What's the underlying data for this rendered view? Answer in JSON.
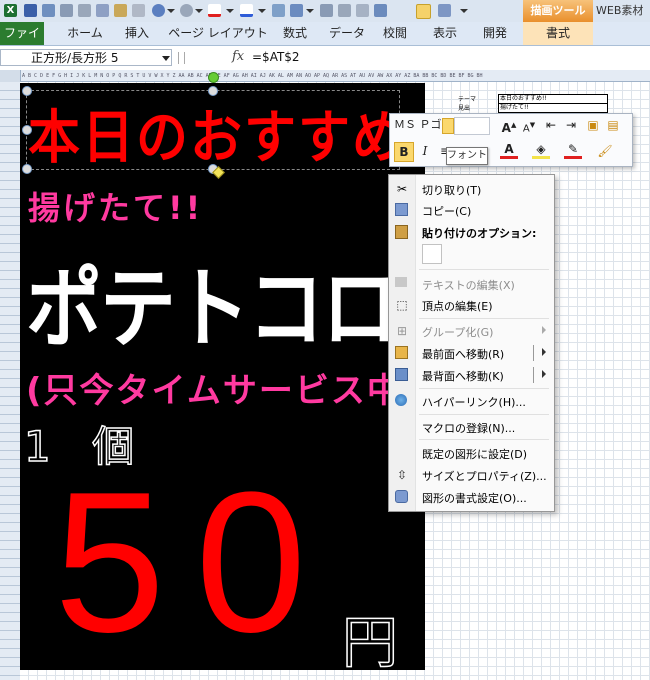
{
  "ribbon": {
    "context_title": "描画ツール",
    "app_title": "WEB素材",
    "tabs": [
      "ファイル",
      "ホーム",
      "挿入",
      "ページ レイアウト",
      "数式",
      "データ",
      "校閲",
      "表示",
      "開発",
      "書式"
    ]
  },
  "formula_bar": {
    "name_box": "正方形/長方形 5",
    "fx": "fx",
    "formula": "=$AT$2"
  },
  "sheet": {
    "column_letters": "A B C D E F G H I J K L M N O P Q R S T U V W X Y Z AA AB AC AD AE AF AG AH AI AJ AK AL AM AN AO AP AQ AR AS AT AU AV AW AX AY AZ BA BB BC BD BE BF BG BH",
    "side_table": {
      "label1": "テーマ",
      "value1": "本日のおすすめ!!",
      "label2": "見出",
      "value2": "揚げたて!!"
    }
  },
  "poster": {
    "headline": "本日のおすすめ!!",
    "sub1": "揚げたて!!",
    "product": "ポテトコロッケ",
    "note": "(只今タイムサービス中!!)",
    "unit": "1 個",
    "price": "50",
    "currency": "円"
  },
  "mini_toolbar": {
    "font": "ＭＳ Ｐゴ",
    "tooltip": "フォント"
  },
  "context_menu": {
    "items": [
      {
        "label": "切り取り(T)",
        "enabled": true
      },
      {
        "label": "コピー(C)",
        "enabled": true
      },
      {
        "label": "貼り付けのオプション:",
        "enabled": true
      },
      {
        "label": "テキストの編集(X)",
        "enabled": false
      },
      {
        "label": "頂点の編集(E)",
        "enabled": true
      },
      {
        "label": "グループ化(G)",
        "enabled": false
      },
      {
        "label": "最前面へ移動(R)",
        "enabled": true
      },
      {
        "label": "最背面へ移動(K)",
        "enabled": true
      },
      {
        "label": "ハイパーリンク(H)...",
        "enabled": true
      },
      {
        "label": "マクロの登録(N)...",
        "enabled": true
      },
      {
        "label": "既定の図形に設定(D)",
        "enabled": true
      },
      {
        "label": "サイズとプロパティ(Z)...",
        "enabled": true
      },
      {
        "label": "図形の書式設定(O)...",
        "enabled": true
      }
    ]
  },
  "colors": {
    "excel_green": "#2b7c2f",
    "poster_red": "#ff0000",
    "poster_pink": "#ff3aa0",
    "context_orange": "#e98f2c"
  }
}
